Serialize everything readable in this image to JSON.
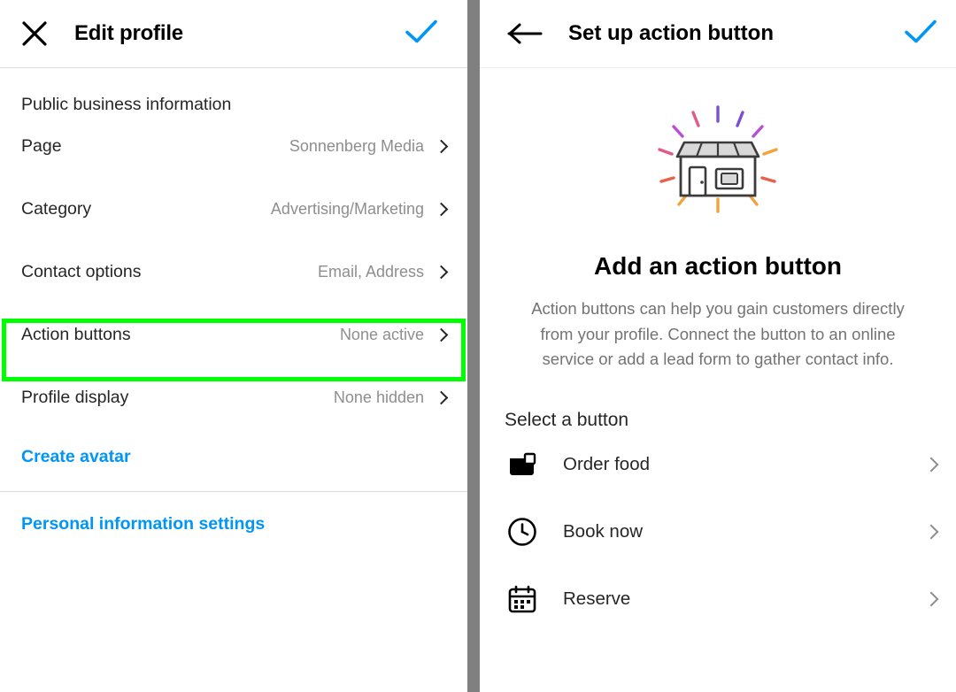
{
  "left": {
    "header": {
      "close_icon": "close-x-icon",
      "title": "Edit profile",
      "confirm_icon": "checkmark-icon"
    },
    "section_title": "Public business information",
    "rows": [
      {
        "label": "Page",
        "value": "Sonnenberg Media",
        "chevron": "chevron-right-icon"
      },
      {
        "label": "Category",
        "value": "Advertising/Marketing",
        "chevron": "chevron-right-icon"
      },
      {
        "label": "Contact options",
        "value": "Email, Address",
        "chevron": "chevron-right-icon"
      },
      {
        "label": "Action buttons",
        "value": "None active",
        "chevron": "chevron-right-icon"
      },
      {
        "label": "Profile display",
        "value": "None hidden",
        "chevron": "chevron-right-icon"
      }
    ],
    "highlight": {
      "row_index": 3,
      "color": "#00ff00"
    },
    "create_avatar_link": "Create avatar",
    "personal_info_link": "Personal information settings"
  },
  "right": {
    "header": {
      "back_icon": "arrow-left-icon",
      "title": "Set up action button",
      "confirm_icon": "checkmark-icon"
    },
    "hero": {
      "illustration": "storefront-illustration",
      "heading": "Add an action button",
      "body": "Action buttons can help you gain customers directly from your profile. Connect the button to an online service or add a lead form to gather contact info."
    },
    "select_label": "Select a button",
    "buttons": [
      {
        "label": "Order food",
        "icon": "order-food-icon",
        "chevron": "chevron-right-icon"
      },
      {
        "label": "Book now",
        "icon": "clock-icon",
        "chevron": "chevron-right-icon"
      },
      {
        "label": "Reserve",
        "icon": "calendar-icon",
        "chevron": "chevron-right-icon"
      }
    ]
  },
  "colors": {
    "accent_blue": "#0095f6",
    "divider": "#dbdbdb",
    "muted_text": "#8e8e8e",
    "highlight_green": "#00ff00",
    "gutter_grey": "#808080"
  }
}
